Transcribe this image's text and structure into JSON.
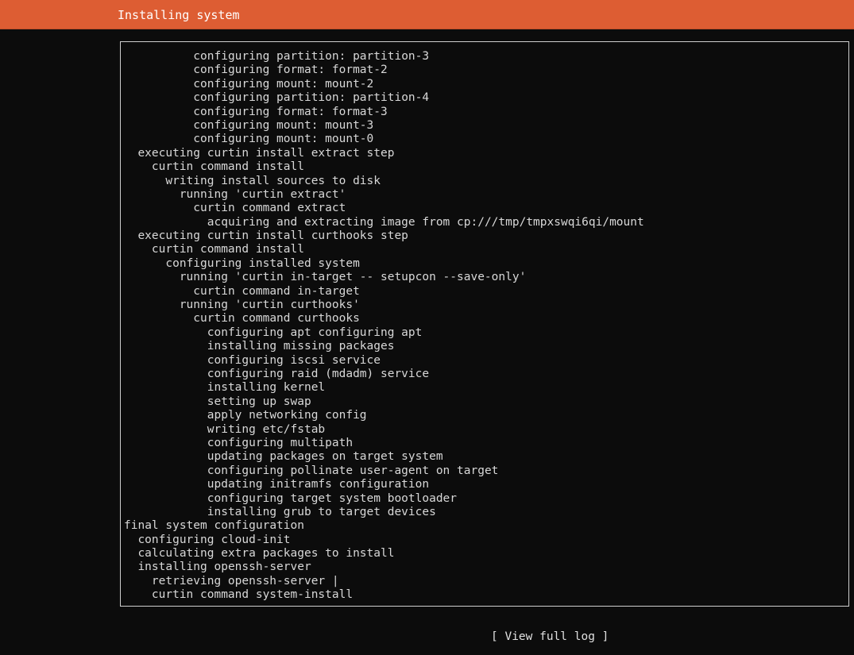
{
  "header": {
    "title": "Installing system"
  },
  "log": {
    "lines": [
      {
        "indent": 5,
        "text": "configuring partition: partition-3"
      },
      {
        "indent": 5,
        "text": "configuring format: format-2"
      },
      {
        "indent": 5,
        "text": "configuring mount: mount-2"
      },
      {
        "indent": 5,
        "text": "configuring partition: partition-4"
      },
      {
        "indent": 5,
        "text": "configuring format: format-3"
      },
      {
        "indent": 5,
        "text": "configuring mount: mount-3"
      },
      {
        "indent": 5,
        "text": "configuring mount: mount-0"
      },
      {
        "indent": 1,
        "text": "executing curtin install extract step"
      },
      {
        "indent": 2,
        "text": "curtin command install"
      },
      {
        "indent": 3,
        "text": "writing install sources to disk"
      },
      {
        "indent": 4,
        "text": "running 'curtin extract'"
      },
      {
        "indent": 5,
        "text": "curtin command extract"
      },
      {
        "indent": 6,
        "text": "acquiring and extracting image from cp:///tmp/tmpxswqi6qi/mount"
      },
      {
        "indent": 1,
        "text": "executing curtin install curthooks step"
      },
      {
        "indent": 2,
        "text": "curtin command install"
      },
      {
        "indent": 3,
        "text": "configuring installed system"
      },
      {
        "indent": 4,
        "text": "running 'curtin in-target -- setupcon --save-only'"
      },
      {
        "indent": 5,
        "text": "curtin command in-target"
      },
      {
        "indent": 4,
        "text": "running 'curtin curthooks'"
      },
      {
        "indent": 5,
        "text": "curtin command curthooks"
      },
      {
        "indent": 6,
        "text": "configuring apt configuring apt"
      },
      {
        "indent": 6,
        "text": "installing missing packages"
      },
      {
        "indent": 6,
        "text": "configuring iscsi service"
      },
      {
        "indent": 6,
        "text": "configuring raid (mdadm) service"
      },
      {
        "indent": 6,
        "text": "installing kernel"
      },
      {
        "indent": 6,
        "text": "setting up swap"
      },
      {
        "indent": 6,
        "text": "apply networking config"
      },
      {
        "indent": 6,
        "text": "writing etc/fstab"
      },
      {
        "indent": 6,
        "text": "configuring multipath"
      },
      {
        "indent": 6,
        "text": "updating packages on target system"
      },
      {
        "indent": 6,
        "text": "configuring pollinate user-agent on target"
      },
      {
        "indent": 6,
        "text": "updating initramfs configuration"
      },
      {
        "indent": 6,
        "text": "configuring target system bootloader"
      },
      {
        "indent": 6,
        "text": "installing grub to target devices"
      },
      {
        "indent": 0,
        "text": "final system configuration"
      },
      {
        "indent": 1,
        "text": "configuring cloud-init"
      },
      {
        "indent": 1,
        "text": "calculating extra packages to install"
      },
      {
        "indent": 1,
        "text": "installing openssh-server"
      },
      {
        "indent": 2,
        "text": "retrieving openssh-server |"
      },
      {
        "indent": 2,
        "text": "curtin command system-install"
      }
    ]
  },
  "footer": {
    "view_log_label": "[ View full log ]"
  }
}
